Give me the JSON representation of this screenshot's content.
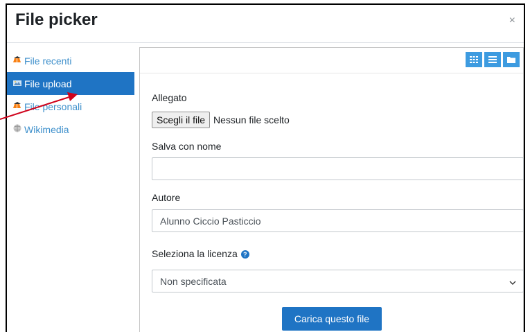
{
  "dialog": {
    "title": "File picker",
    "close_glyph": "×"
  },
  "sidebar": {
    "items": [
      {
        "label": "File recenti",
        "icon": "moodle-icon",
        "active": false
      },
      {
        "label": "File upload",
        "icon": "upload-icon",
        "active": true
      },
      {
        "label": "File personali",
        "icon": "moodle-icon",
        "active": false
      },
      {
        "label": "Wikimedia",
        "icon": "wikimedia-icon",
        "active": false
      }
    ]
  },
  "toolbar": {
    "view_buttons": [
      "grid-view-icon",
      "list-view-icon",
      "folder-view-icon"
    ]
  },
  "form": {
    "attachment_label": "Allegato",
    "choose_file_button": "Scegli il file",
    "no_file_text": "Nessun file scelto",
    "save_as_label": "Salva con nome",
    "save_as_value": "",
    "author_label": "Autore",
    "author_value": "Alunno Ciccio Pasticcio",
    "license_label": "Seleziona la licenza",
    "license_value": "Non specificata",
    "upload_button": "Carica questo file"
  },
  "colors": {
    "primary": "#1f74c4",
    "link": "#3d8fcb",
    "view_button": "#3d9be0",
    "annotation_arrow": "#d0021b"
  }
}
